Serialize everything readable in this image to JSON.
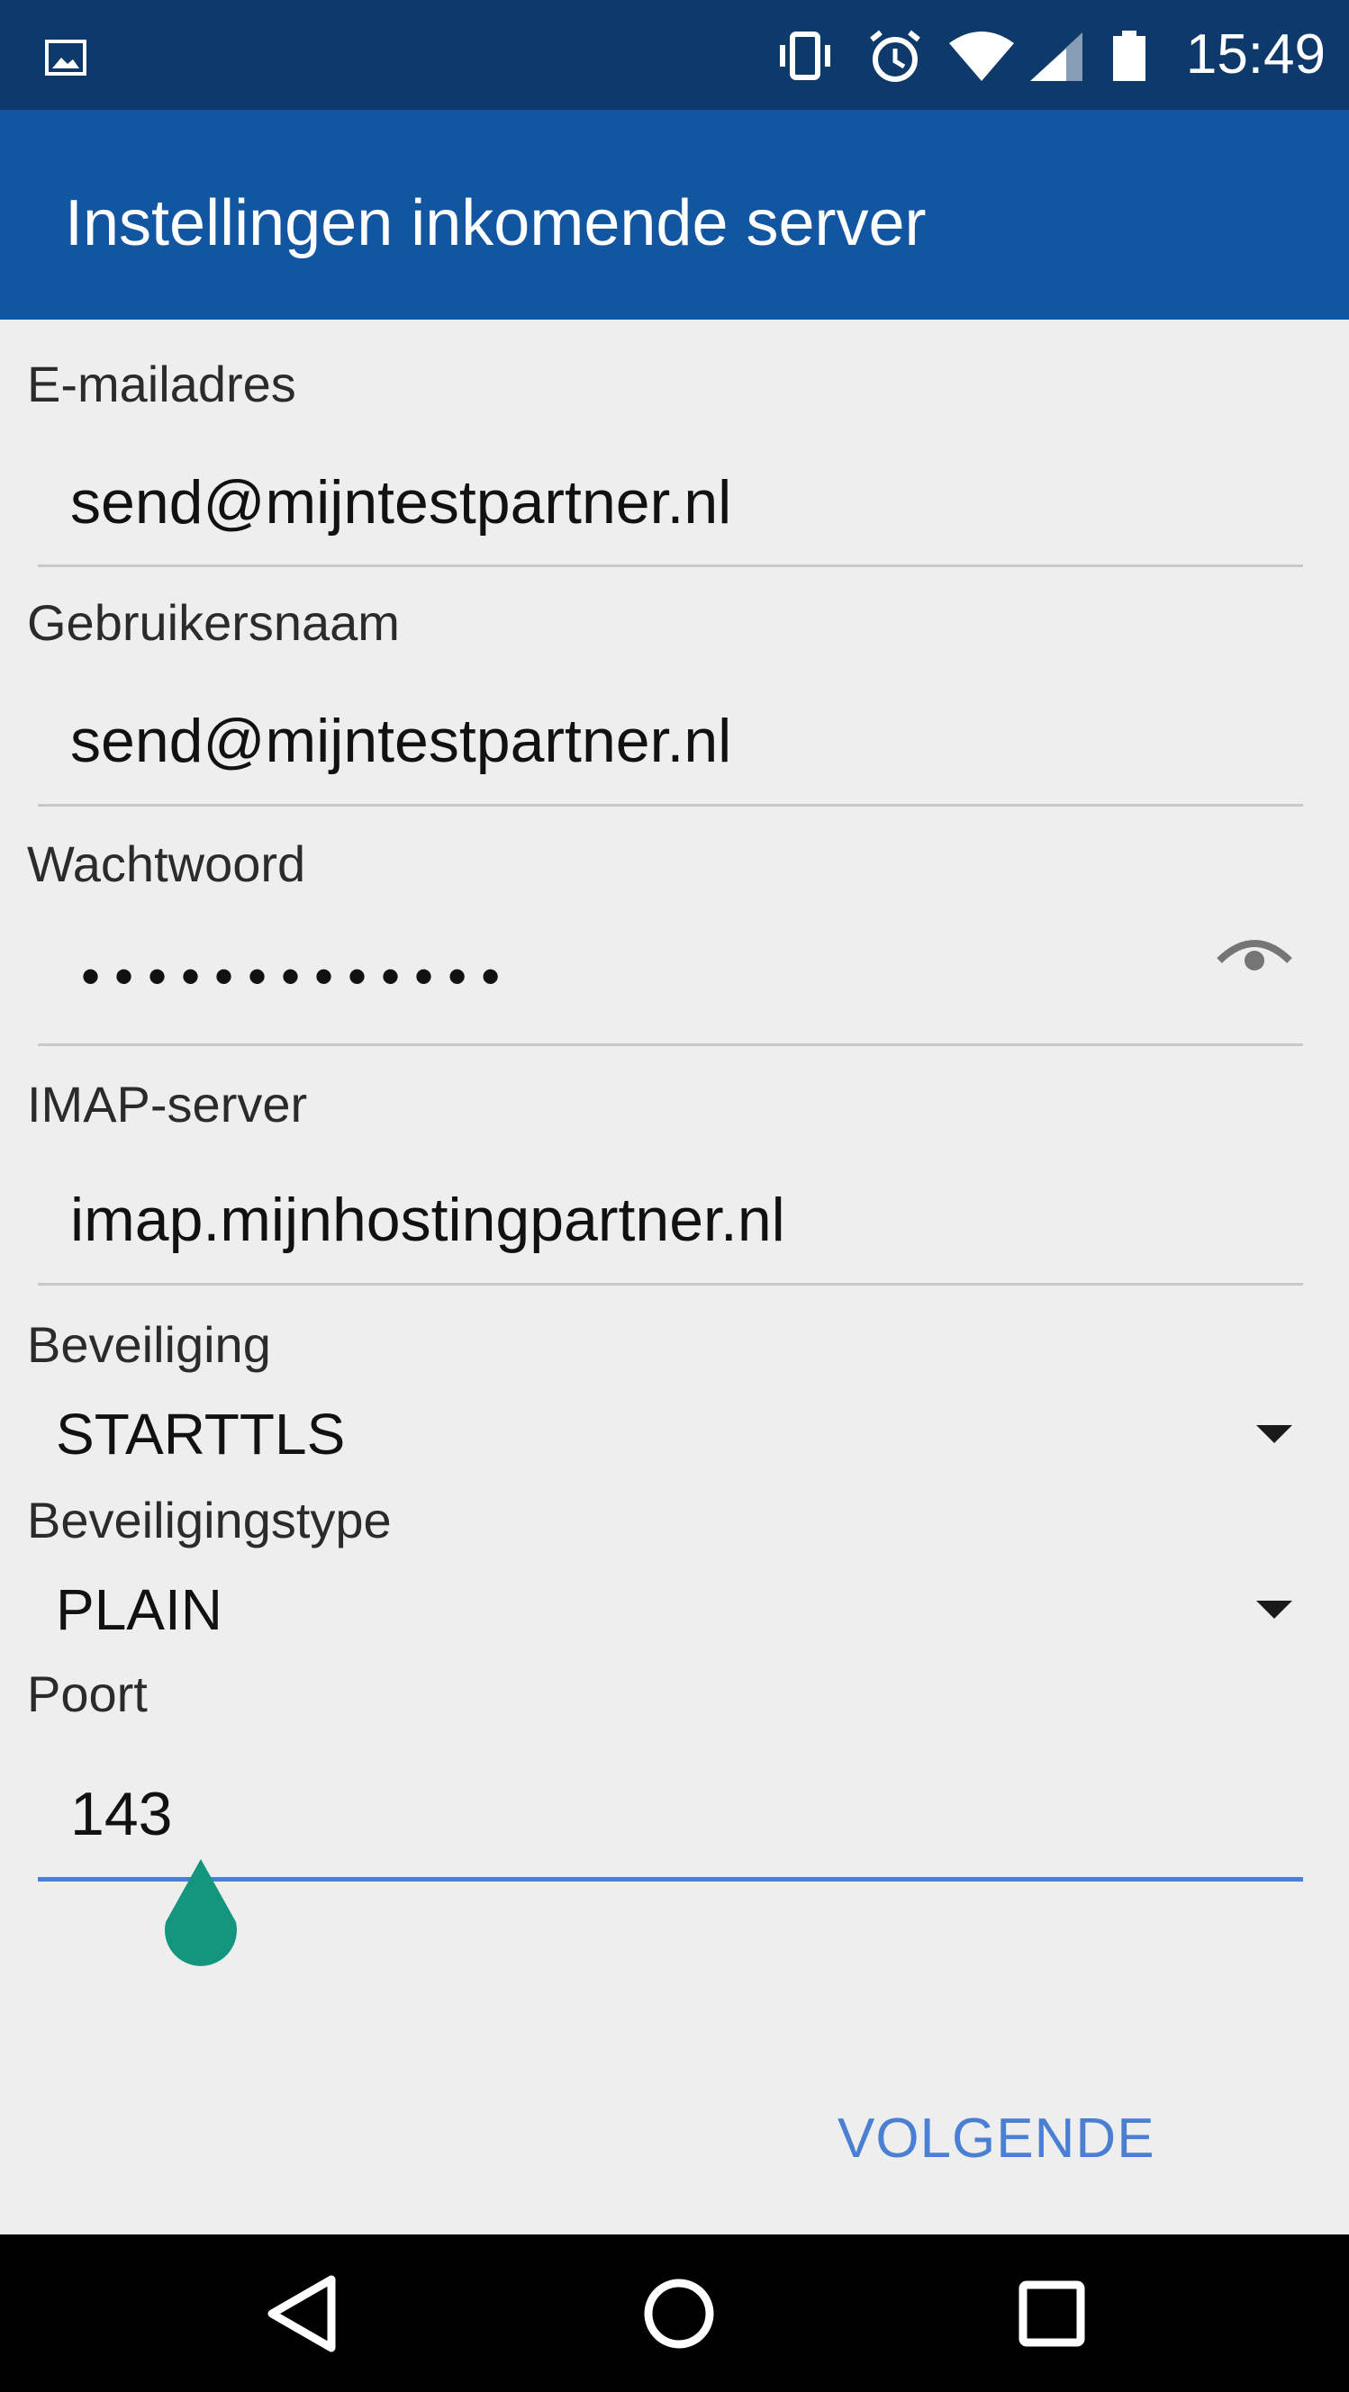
{
  "status_bar": {
    "time": "15:49",
    "icons": [
      "gallery-icon",
      "vibrate-icon",
      "alarm-icon",
      "wifi-icon",
      "signal-icon",
      "battery-icon"
    ],
    "background": "#0e3a6b"
  },
  "app_bar": {
    "title": "Instellingen inkomende server",
    "background": "#1256a2"
  },
  "form": {
    "email": {
      "label": "E-mailadres",
      "value": "send@mijntestpartner.nl"
    },
    "username": {
      "label": "Gebruikersnaam",
      "value": "send@mijntestpartner.nl"
    },
    "password": {
      "label": "Wachtwoord",
      "masked": "•••••••••••••",
      "toggle_icon": "eye-icon"
    },
    "imap_server": {
      "label": "IMAP-server",
      "value": "imap.mijnhostingpartner.nl"
    },
    "security": {
      "label": "Beveiliging",
      "selected": "STARTTLS"
    },
    "security_type": {
      "label": "Beveiligingstype",
      "selected": "PLAIN"
    },
    "port": {
      "label": "Poort",
      "value": "143"
    },
    "accent_color": "#4a7fd3",
    "handle_color": "#14957e"
  },
  "footer": {
    "next_label": "VOLGENDE"
  },
  "nav_bar": {
    "icons": [
      "back-icon",
      "home-icon",
      "recents-icon"
    ]
  }
}
